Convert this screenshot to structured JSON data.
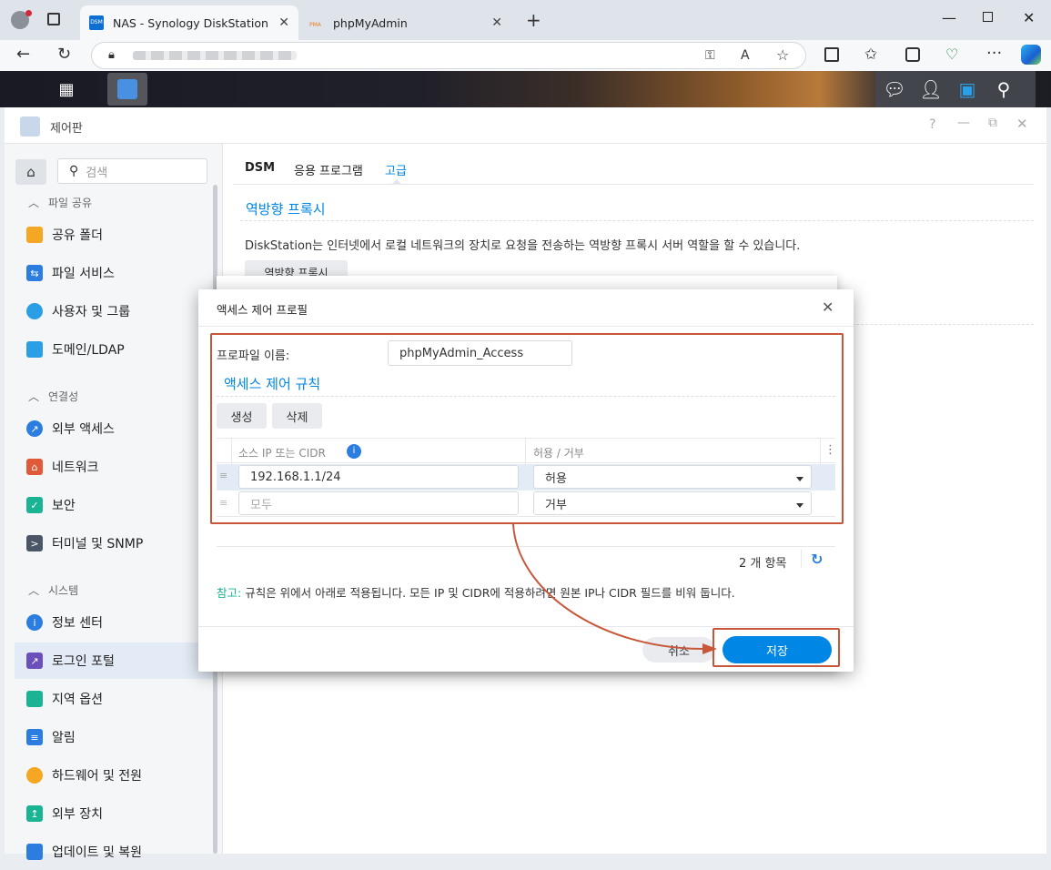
{
  "browser": {
    "tabs": [
      {
        "label": "NAS - Synology DiskStation",
        "favicon": "DSM",
        "active": true
      },
      {
        "label": "phpMyAdmin",
        "favicon": "PMA",
        "active": false
      }
    ]
  },
  "window": {
    "title": "제어판"
  },
  "search": {
    "placeholder": "검색"
  },
  "sidebar": {
    "sections": [
      {
        "label": "파일 공유"
      },
      {
        "label": "연결성"
      },
      {
        "label": "시스템"
      }
    ],
    "items": [
      {
        "label": "공유 폴더",
        "icon": "folder-icon",
        "color": "#f5a623"
      },
      {
        "label": "파일 서비스",
        "icon": "file-services-icon",
        "color": "#2b7de0"
      },
      {
        "label": "사용자 및 그룹",
        "icon": "users-icon",
        "color": "#2b9fe6"
      },
      {
        "label": "도메인/LDAP",
        "icon": "domain-icon",
        "color": "#2b9fe6"
      },
      {
        "label": "외부 액세스",
        "icon": "external-access-icon",
        "color": "#2b7de0"
      },
      {
        "label": "네트워크",
        "icon": "network-icon",
        "color": "#e05a3a"
      },
      {
        "label": "보안",
        "icon": "shield-icon",
        "color": "#1ab394"
      },
      {
        "label": "터미널 및 SNMP",
        "icon": "terminal-icon",
        "color": "#4a5568"
      },
      {
        "label": "정보 센터",
        "icon": "info-icon",
        "color": "#2b7de0"
      },
      {
        "label": "로그인 포털",
        "icon": "login-portal-icon",
        "color": "#6b4fbb"
      },
      {
        "label": "지역 옵션",
        "icon": "globe-icon",
        "color": "#1ab394"
      },
      {
        "label": "알림",
        "icon": "chat-icon",
        "color": "#2b7de0"
      },
      {
        "label": "하드웨어 및 전원",
        "icon": "bulb-icon",
        "color": "#f5a623"
      },
      {
        "label": "외부 장치",
        "icon": "device-icon",
        "color": "#1ab394"
      },
      {
        "label": "업데이트 및 복원",
        "icon": "update-icon",
        "color": "#2b7de0"
      }
    ]
  },
  "main": {
    "tabs": [
      {
        "label": "DSM"
      },
      {
        "label": "응용 프로그램"
      },
      {
        "label": "고급"
      }
    ],
    "section_title": "역방향 프록시",
    "description": "DiskStation는 인터넷에서 로컬 네트워크의 장치로 요청을 전송하는 역방향 프록시 서버 역할을 할 수 있습니다.",
    "proxy_button": "역방향 프록시"
  },
  "dialog": {
    "title": "액세스 제어 프로필",
    "profile_name_label": "프로파일 이름:",
    "profile_name_value": "phpMyAdmin_Access",
    "rules_title": "액세스 제어 규칙",
    "create_button": "생성",
    "delete_button": "삭제",
    "columns": [
      "소스 IP 또는 CIDR",
      "허용 / 거부"
    ],
    "rows": [
      {
        "source": "192.168.1.1/24",
        "action": "허용"
      },
      {
        "source": "",
        "source_placeholder": "모두",
        "action": "거부"
      }
    ],
    "count_text": "2 개 항목",
    "note_label": "참고:",
    "note_text": " 규칙은 위에서 아래로 적용됩니다. 모든 IP 및 CIDR에 적용하려면 원본 IP나 CIDR 필드를 비워 둡니다.",
    "cancel_button": "취소",
    "save_button": "저장"
  },
  "colors": {
    "accent": "#0086e5",
    "highlight": "#c8573a"
  }
}
